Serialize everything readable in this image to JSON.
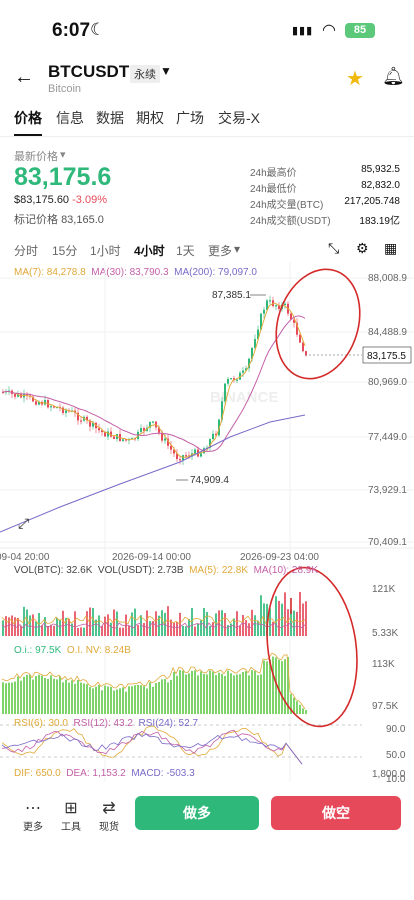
{
  "status": {
    "time": "6:07",
    "battery": "85"
  },
  "header": {
    "symbol": "BTCUSDT",
    "tag": "永续",
    "name": "Bitcoin",
    "back_icon": "arrow-left-icon",
    "star_icon": "star-icon",
    "bell_icon": "bell-icon"
  },
  "tabs": [
    "价格",
    "信息",
    "数据",
    "期权",
    "广场",
    "交易-X"
  ],
  "price_block": {
    "label": "最新价格",
    "last": "83,175.6",
    "usd": "$83,175.60",
    "change": "-3.09%",
    "mark_label": "标记价格",
    "mark": "83,165.0"
  },
  "stats": [
    {
      "label": "24h最高价",
      "value": "85,932.5"
    },
    {
      "label": "24h最低价",
      "value": "82,832.0"
    },
    {
      "label": "24h成交量(BTC)",
      "value": "217,205.748"
    },
    {
      "label": "24h成交额(USDT)",
      "value": "183.19亿"
    }
  ],
  "timeframes": [
    "分时",
    "15分",
    "1小时",
    "4小时",
    "1天",
    "更多"
  ],
  "active_timeframe": "4小时",
  "ma_legend": {
    "ma7": "MA(7): 84,278.8",
    "ma30": "MA(30): 83,790.3",
    "ma200": "MA(200): 79,097.0"
  },
  "price_axis": [
    "88,008.9",
    "84,488.9",
    "80,969.0",
    "77,449.0",
    "73,929.1",
    "70,409.1"
  ],
  "last_price_tag": "83,175.5",
  "high_marker": "87,385.1",
  "low_marker": "74,909.4",
  "watermark": "BINANCE",
  "time_axis": [
    "09-04 20:00",
    "2026-09-14 00:00",
    "2026-09-23 04:00"
  ],
  "vol_legend": {
    "btc": "VOL(BTC): 32.6K",
    "usdt": "VOL(USDT): 2.73B",
    "ma5": "MA(5): 22.8K",
    "ma10": "MA(10): 28.9K"
  },
  "vol_axis": [
    "121K",
    "5.33K"
  ],
  "oi_legend": {
    "oi": "O.i.: 97.5K",
    "oinv": "O.I. NV: 8.24B"
  },
  "oi_axis": [
    "113K",
    "97.5K"
  ],
  "rsi_legend": {
    "r6": "RSI(6): 30.0",
    "r12": "RSI(12): 43.2",
    "r24": "RSI(24): 52.7"
  },
  "rsi_axis": [
    "90.0",
    "50.0",
    "10.0"
  ],
  "macd_legend": {
    "dif": "DIF: 650.0",
    "dea": "DEA: 1,153.2",
    "macd": "MACD: -503.3"
  },
  "macd_axis": [
    "1,800.0"
  ],
  "bottom": {
    "more": "更多",
    "tools": "工具",
    "spot": "现货",
    "long": "做多",
    "short": "做空"
  },
  "colors": {
    "green": "#2eb87a",
    "red": "#e64a5a",
    "ma7": "#e0a93a",
    "ma30": "#c35fa8",
    "ma200": "#7b69c8"
  }
}
